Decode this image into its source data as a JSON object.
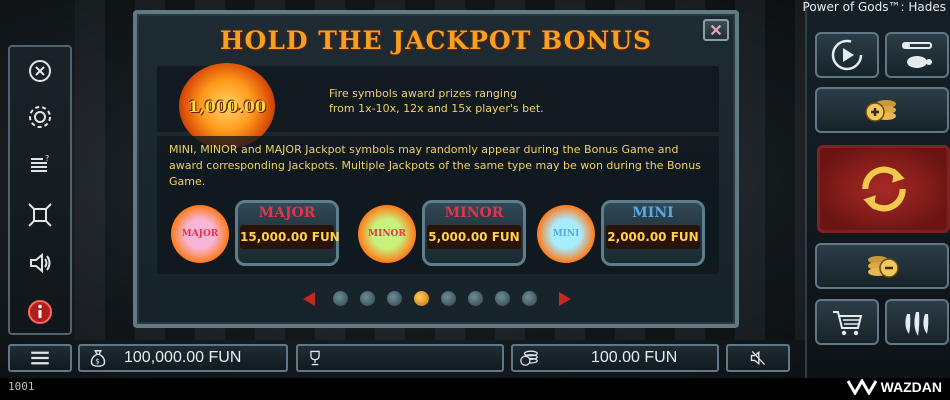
{
  "header": {
    "game_title": "Power of Gods™: Hades"
  },
  "modal": {
    "title": "HOLD THE JACKPOT BONUS",
    "fire_symbol": {
      "value": "1,000.00",
      "description_line1": "Fire symbols award prizes ranging",
      "description_line2": "from 1x-10x, 12x and 15x player's bet."
    },
    "jackpot_description": "MINI, MINOR and MAJOR Jackpot symbols may randomly appear during the Bonus Game and award corresponding Jackpots. Multiple Jackpots of the same type may be won during the Bonus Game.",
    "jackpots": [
      {
        "orb_label": "MAJOR",
        "name": "MAJOR",
        "value": "15,000.00 FUN",
        "orb_color": "#f7b6d8",
        "name_color": "#e5344a"
      },
      {
        "orb_label": "MINOR",
        "name": "MINOR",
        "value": "5,000.00 FUN",
        "orb_color": "#c9f27c",
        "name_color": "#e5344a"
      },
      {
        "orb_label": "MINI",
        "name": "MINI",
        "value": "2,000.00 FUN",
        "orb_color": "#a8ecff",
        "name_color": "#5aa8e6"
      }
    ],
    "pager": {
      "page_count": 8,
      "active_index": 3
    }
  },
  "bottom_bar": {
    "balance": "100,000.00 FUN",
    "win": "",
    "bet": "100.00 FUN"
  },
  "footer": {
    "version": "1001",
    "brand": "WAZDAN"
  },
  "colors": {
    "accent": "#f5a01e",
    "text_gold": "#f0d25c",
    "spin_red": "#a82a25"
  }
}
